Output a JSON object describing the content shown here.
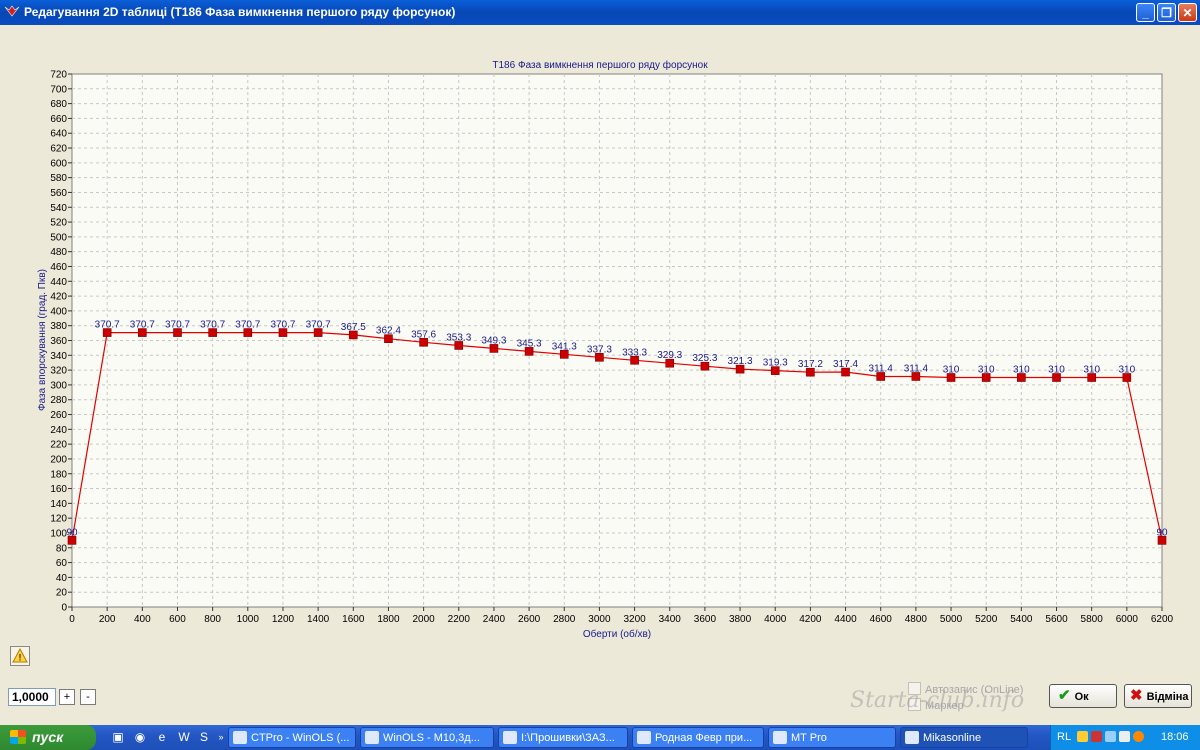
{
  "window": {
    "title": "Редагування 2D таблиці (T186 Фаза вимкнення першого ряду форсунок)",
    "minimize": "_",
    "restore": "❐",
    "close": "✕"
  },
  "chart_data": {
    "type": "line",
    "title": "T186 Фаза вимкнення першого ряду форсунок",
    "xlabel": "Оберти (об/хв)",
    "ylabel": "Фаза впорскування (град. Пкв)",
    "xlim": [
      0,
      6200
    ],
    "ylim": [
      0,
      720
    ],
    "x_ticks": [
      0,
      200,
      400,
      600,
      800,
      1000,
      1200,
      1400,
      1600,
      1800,
      2000,
      2200,
      2400,
      2600,
      2800,
      3000,
      3200,
      3400,
      3600,
      3800,
      4000,
      4200,
      4400,
      4600,
      4800,
      5000,
      5200,
      5400,
      5600,
      5800,
      6000,
      6200
    ],
    "y_ticks": [
      0,
      20,
      40,
      60,
      80,
      100,
      120,
      140,
      160,
      180,
      200,
      220,
      240,
      260,
      280,
      300,
      320,
      340,
      360,
      380,
      400,
      420,
      440,
      460,
      480,
      500,
      520,
      540,
      560,
      580,
      600,
      620,
      640,
      660,
      680,
      700,
      720
    ],
    "grid": true,
    "series": [
      {
        "color": "#e00000",
        "marker_color": "#cc0000",
        "label_color": "#1a1a8c",
        "x": [
          0,
          200,
          400,
          600,
          800,
          1000,
          1200,
          1400,
          1600,
          1800,
          2000,
          2200,
          2400,
          2600,
          2800,
          3000,
          3200,
          3400,
          3600,
          3800,
          4000,
          4200,
          4400,
          4600,
          4800,
          5000,
          5200,
          5400,
          5600,
          5800,
          6000,
          6200
        ],
        "values": [
          90,
          370.7,
          370.7,
          370.7,
          370.7,
          370.7,
          370.7,
          370.7,
          367.5,
          362.4,
          357.6,
          353.3,
          349.3,
          345.3,
          341.3,
          337.3,
          333.3,
          329.3,
          325.3,
          321.3,
          319.3,
          317.2,
          317.4,
          311.4,
          311.4,
          310,
          310,
          310,
          310,
          310,
          310,
          90
        ],
        "labels": [
          "90",
          "370.7",
          "370.7",
          "370.7",
          "370.7",
          "370.7",
          "370.7",
          "370.7",
          "367.5",
          "362.4",
          "357.6",
          "353.3",
          "349.3",
          "345.3",
          "341.3",
          "337.3",
          "333.3",
          "329.3",
          "325.3",
          "321.3",
          "319.3",
          "317.2",
          "317.4",
          "311.4",
          "311.4",
          "310",
          "310",
          "310",
          "310",
          "310",
          "310",
          "90"
        ]
      }
    ]
  },
  "controls": {
    "step_value": "1,0000",
    "plus": "+",
    "minus": "-",
    "autosave_label": "Автозапис (OnLine)",
    "marker_label": "Маркер",
    "ok_label": "Ок",
    "cancel_label": "Відміна",
    "watermark": "Starta-club.info"
  },
  "taskbar": {
    "start_label": "пуск",
    "tasks": [
      {
        "label": "CTPro - WinOLS (..."
      },
      {
        "label": "WinOLS - M10,3д..."
      },
      {
        "label": "I:\\Прошивки\\ЗАЗ..."
      },
      {
        "label": "Родная Февр при..."
      },
      {
        "label": "MT Pro"
      },
      {
        "label": "Mikasonline"
      }
    ],
    "language": "RL",
    "clock": "18:06"
  }
}
